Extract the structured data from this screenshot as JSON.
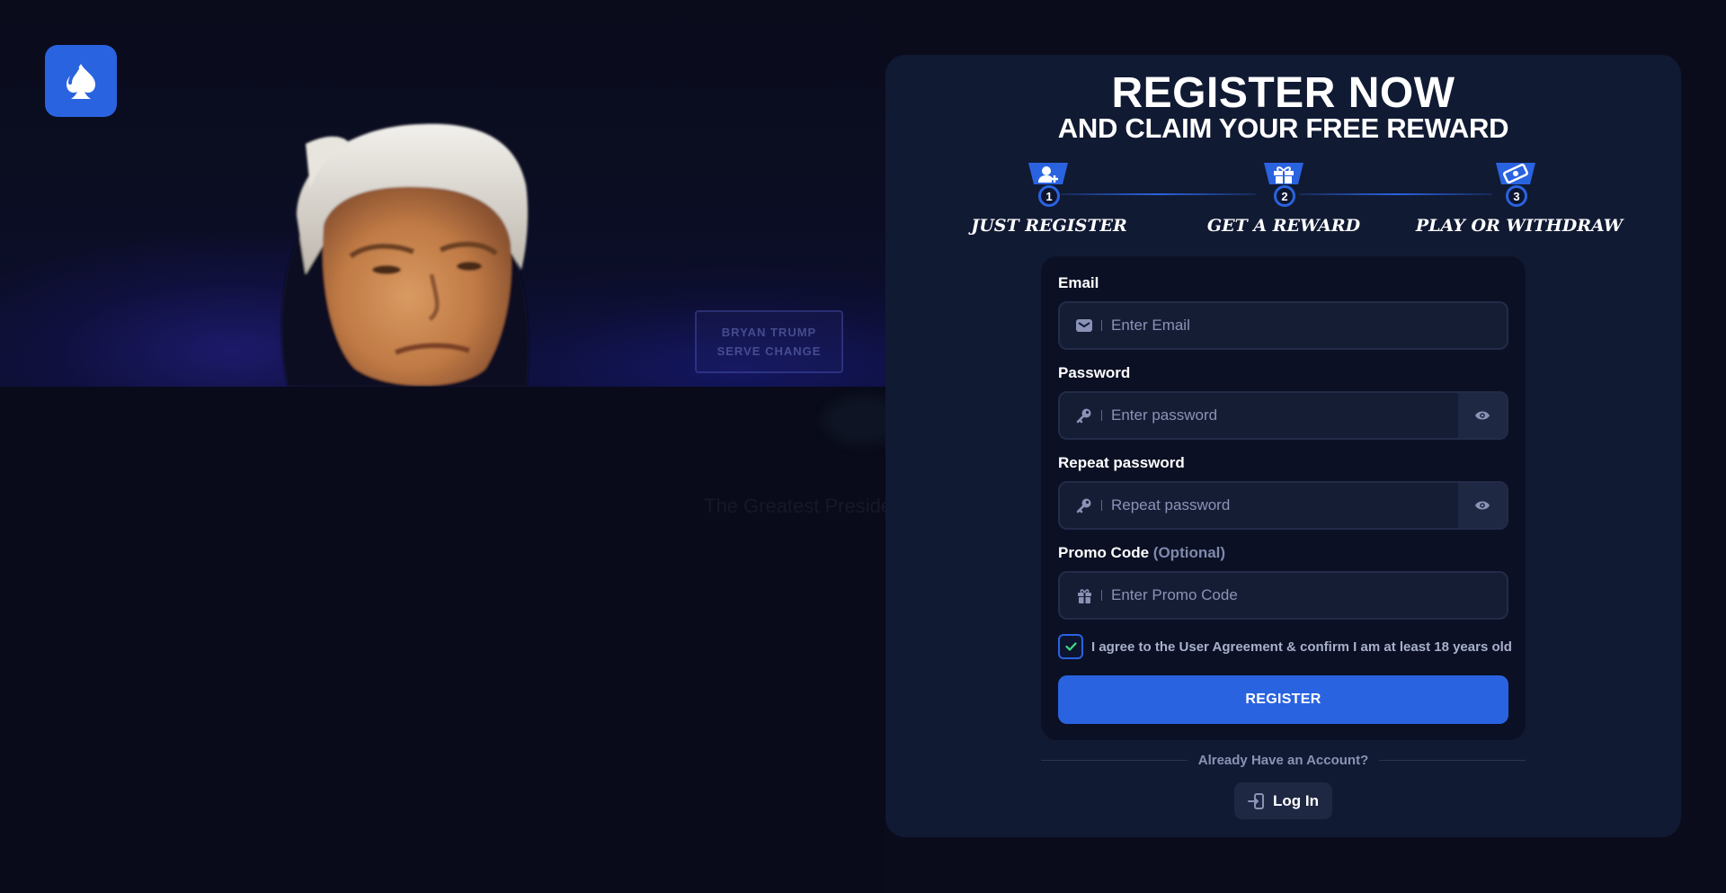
{
  "brand": {
    "logo_icon": "spade-icon",
    "accent": "#2a63e0"
  },
  "hero": {
    "podium_sign": [
      "BRYAN",
      "TRUMP",
      "SERVE",
      "CHANGE"
    ],
    "faint_tagline": "The Greatest Presidency Begins"
  },
  "header": {
    "title": "REGISTER NOW",
    "subtitle": "AND CLAIM YOUR FREE REWARD"
  },
  "steps": [
    {
      "number": "1",
      "label": "JUST REGISTER",
      "icon": "user-plus-icon"
    },
    {
      "number": "2",
      "label": "GET A REWARD",
      "icon": "gift-icon"
    },
    {
      "number": "3",
      "label": "PLAY OR WITHDRAW",
      "icon": "cash-icon"
    }
  ],
  "form": {
    "email": {
      "label": "Email",
      "placeholder": "Enter Email",
      "value": "",
      "icon": "envelope-icon"
    },
    "password": {
      "label": "Password",
      "placeholder": "Enter password",
      "value": "",
      "icon": "key-icon"
    },
    "repeat_password": {
      "label": "Repeat password",
      "placeholder": "Repeat password",
      "value": "",
      "icon": "key-icon"
    },
    "promo": {
      "label": "Promo Code",
      "optional": "(Optional)",
      "placeholder": "Enter Promo Code",
      "value": "",
      "icon": "gift-icon"
    },
    "agree": {
      "text": "I agree to the User Agreement & confirm I am at least 18 years old",
      "checked": true
    },
    "register_label": "REGISTER"
  },
  "footer": {
    "have_account": "Already Have an Account?",
    "login_label": "Log In"
  }
}
